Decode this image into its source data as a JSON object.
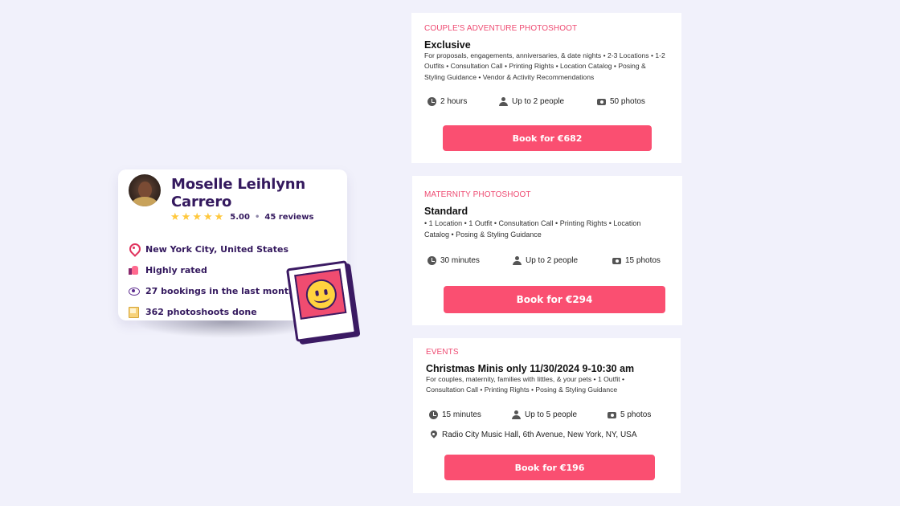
{
  "profile": {
    "name": "Moselle Leihlynn Carrero",
    "rating": "5.00",
    "reviews": "45 reviews",
    "stars_filled": 5,
    "features": [
      {
        "icon": "map-pin-icon",
        "text": "New York City, United States"
      },
      {
        "icon": "thumbs-up-icon",
        "text": "Highly rated"
      },
      {
        "icon": "eye-icon",
        "text": "27 bookings in the last month"
      },
      {
        "icon": "photo-album-icon",
        "text": "362 photoshoots done"
      }
    ]
  },
  "packages": [
    {
      "category": "COUPLE'S ADVENTURE PHOTOSHOOT",
      "title": "Exclusive",
      "description": "For proposals, engagements, anniversaries, & date nights • 2-3 Locations • 1-2 Outfits • Consultation Call • Printing Rights • Location Catalog • Posing & Styling Guidance • Vendor & Activity Recommendations",
      "duration": "2 hours",
      "people": "Up to 2 people",
      "photos": "50 photos",
      "button": "Book for €682"
    },
    {
      "category": "MATERNITY PHOTOSHOOT",
      "title": "Standard",
      "description": "• 1 Location • 1 Outfit • Consultation Call • Printing Rights • Location Catalog • Posing & Styling Guidance",
      "duration": "30 minutes",
      "people": "Up to 2 people",
      "photos": "15 photos",
      "button": "Book for €294"
    },
    {
      "category": "EVENTS",
      "title": "Christmas Minis only 11/30/2024 9-10:30 am",
      "description": "For couples, maternity, families with littles, & your pets • 1 Outfit • Consultation Call • Printing Rights • Posing & Styling Guidance",
      "duration": "15 minutes",
      "people": "Up to 5 people",
      "photos": "5 photos",
      "location": "Radio City Music Hall, 6th Avenue, New York, NY, USA",
      "button": "Book for €196"
    }
  ],
  "colors": {
    "background": "#f1f1fb",
    "brand_purple": "#34195e",
    "accent_pink": "#fa4f71",
    "star_yellow": "#ffc83d"
  }
}
